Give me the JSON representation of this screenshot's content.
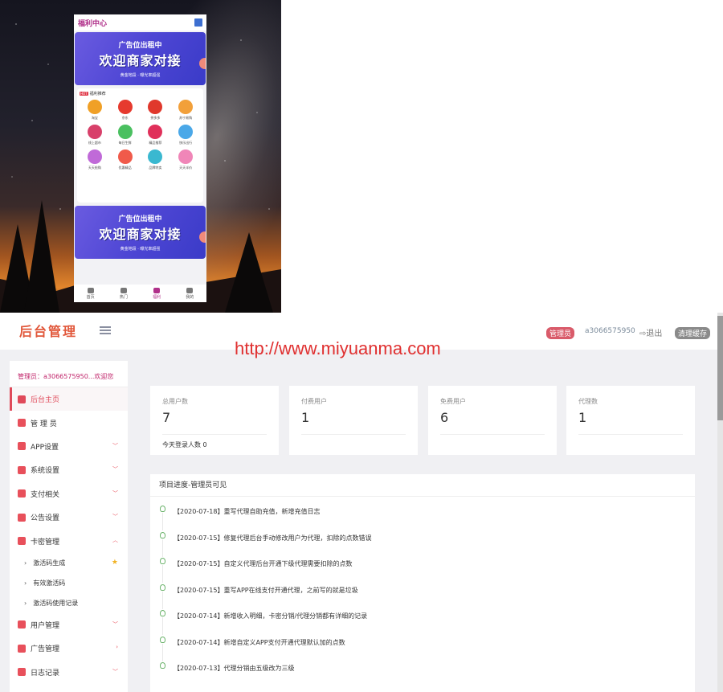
{
  "mobile": {
    "header_title": "福利中心",
    "banner_top": {
      "line1": "广告位出租中",
      "line2": "欢迎商家对接",
      "footer": "黄金地段 · 曝光率超强"
    },
    "recommend": {
      "hot_badge": "HOT",
      "title": "福利推荐",
      "items": [
        {
          "label": "淘宝",
          "color": "#f0a026"
        },
        {
          "label": "京东",
          "color": "#e63a2e"
        },
        {
          "label": "拼多多",
          "color": "#e0382c"
        },
        {
          "label": "苏宁易购",
          "color": "#f2a03a"
        },
        {
          "label": "线上超市",
          "color": "#d8406a"
        },
        {
          "label": "每日生鲜",
          "color": "#4ac060"
        },
        {
          "label": "精品推荐",
          "color": "#e0305a"
        },
        {
          "label": "快乐出行",
          "color": "#4aa8e8"
        },
        {
          "label": "天天抢购",
          "color": "#c06ad8"
        },
        {
          "label": "优惠精品",
          "color": "#f05a4a"
        },
        {
          "label": "品牌特卖",
          "color": "#3ab8d0"
        },
        {
          "label": "天天半价",
          "color": "#f086b8"
        }
      ]
    },
    "banner_bottom": {
      "line1": "广告位出租中",
      "line2": "欢迎商家对接",
      "footer": "黄金地段 · 曝光率超强"
    },
    "nav": [
      {
        "label": "首页"
      },
      {
        "label": "热门"
      },
      {
        "label": "福利"
      },
      {
        "label": "我的"
      }
    ]
  },
  "admin": {
    "logo": "后台管理",
    "role_badge": "管理员",
    "account": "a3066575950",
    "logout": "⇨退出",
    "clear_cache": "清理缓存",
    "watermark": "http://www.miyuanma.com",
    "welcome": "管理员：a3066575950...欢迎您",
    "menu": [
      {
        "label": "后台主页",
        "active": true
      },
      {
        "label": "管 理 员"
      },
      {
        "label": "APP设置",
        "chevron": "v"
      },
      {
        "label": "系统设置",
        "chevron": "v"
      },
      {
        "label": "支付相关",
        "chevron": "v"
      },
      {
        "label": "公告设置",
        "chevron": "v"
      },
      {
        "label": "卡密管理",
        "chevron": "^"
      }
    ],
    "submenu": [
      {
        "label": "激活码生成"
      },
      {
        "label": "有效激活码"
      },
      {
        "label": "激活码使用记录"
      }
    ],
    "menu2": [
      {
        "label": "用户管理",
        "chevron": "v"
      },
      {
        "label": "广告管理",
        "chevron": ">"
      },
      {
        "label": "日志记录",
        "chevron": "v"
      }
    ],
    "stats": [
      {
        "label": "总用户数",
        "value": "7"
      },
      {
        "label": "付费用户",
        "value": "1"
      },
      {
        "label": "免费用户",
        "value": "6"
      },
      {
        "label": "代理数",
        "value": "1"
      }
    ],
    "login_today": "今天登录人数   0",
    "progress_title": "项目进度-管理员可见",
    "timeline": [
      "【2020-07-18】重写代理自助充值，新增充值日志",
      "【2020-07-15】修复代理后台手动修改用户为代理，扣除的点数错误",
      "【2020-07-15】自定义代理后台开通下级代理需要扣除的点数",
      "【2020-07-15】重写APP在线支付开通代理，之前写的就是垃圾",
      "【2020-07-14】新增收入明细，卡密分销/代理分销都有详细的记录",
      "【2020-07-14】新增自定义APP支付开通代理默认加的点数",
      "【2020-07-13】代理分销由五级改为三级"
    ]
  }
}
